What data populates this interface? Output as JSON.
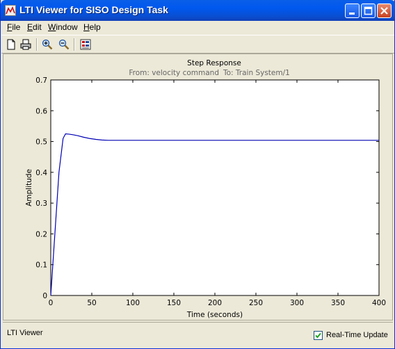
{
  "window": {
    "title": "LTI Viewer for SISO Design Task",
    "controls": [
      "minimize-icon",
      "maximize-icon",
      "close-icon"
    ]
  },
  "menu": {
    "items": [
      {
        "label": "File",
        "underline": "F"
      },
      {
        "label": "Edit",
        "underline": "E"
      },
      {
        "label": "Window",
        "underline": "W"
      },
      {
        "label": "Help",
        "underline": "H"
      }
    ]
  },
  "toolbar": {
    "icons": [
      "new-document-icon",
      "print-icon",
      "zoom-in-icon",
      "zoom-out-icon",
      "plot-configurations-icon"
    ]
  },
  "plot": {
    "title": "Step Response",
    "subtitle_from": "From: velocity command",
    "subtitle_to": "To: Train System/1"
  },
  "chart_data": {
    "type": "line",
    "title": "Step Response",
    "xlabel": "Time (seconds)",
    "ylabel": "Amplitude",
    "xlim": [
      0,
      400
    ],
    "ylim": [
      0,
      0.7
    ],
    "xticks": [
      0,
      50,
      100,
      150,
      200,
      250,
      300,
      350,
      400
    ],
    "yticks": [
      0,
      0.1,
      0.2,
      0.3,
      0.4,
      0.5,
      0.6,
      0.7
    ],
    "grid": false,
    "line_color": "#0000b4",
    "series": [
      {
        "x": [
          0,
          5,
          10,
          15,
          18,
          22,
          27,
          33,
          40,
          47,
          55,
          62,
          70,
          80,
          100,
          150,
          200,
          300,
          400
        ],
        "y": [
          0.0,
          0.2,
          0.4,
          0.51,
          0.525,
          0.524,
          0.522,
          0.519,
          0.514,
          0.51,
          0.507,
          0.505,
          0.504,
          0.504,
          0.504,
          0.504,
          0.504,
          0.504,
          0.504
        ]
      }
    ]
  },
  "status": {
    "text": "LTI Viewer",
    "realtime_label": "Real-Time Update",
    "realtime_checked": true
  }
}
